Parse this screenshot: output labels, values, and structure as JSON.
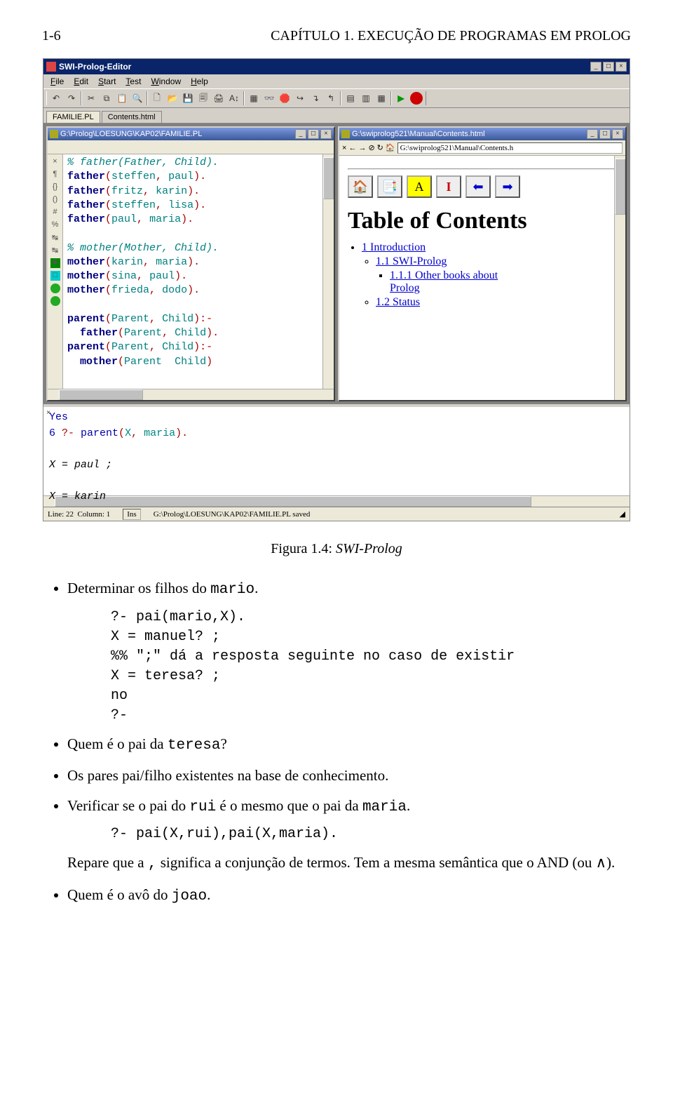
{
  "header": {
    "page_no": "1-6",
    "chapter": "CAPÍTULO 1. EXECUÇÃO DE PROGRAMAS EM PROLOG"
  },
  "caption": {
    "label": "Figura 1.4:",
    "text": "SWI-Prolog"
  },
  "app": {
    "title": "SWI-Prolog-Editor",
    "menu": [
      "File",
      "Edit",
      "Start",
      "Test",
      "Window",
      "Help"
    ],
    "tabs": [
      "FAMILIE.PL",
      "Contents.html"
    ],
    "left": {
      "title": "G:\\Prolog\\LOESUNG\\KAP02\\FAMILIE.PL",
      "gutter": [
        "×",
        "¶",
        "{}",
        "()",
        "#",
        "%",
        "↹",
        "↹",
        "■",
        "□",
        "✻",
        "✻"
      ],
      "code": [
        {
          "t": "com",
          "s": "% father(Father, Child)."
        },
        {
          "t": "l",
          "s": "father(steffen, paul)."
        },
        {
          "t": "l",
          "s": "father(fritz, karin)."
        },
        {
          "t": "l",
          "s": "father(steffen, lisa)."
        },
        {
          "t": "l",
          "s": "father(paul, maria)."
        },
        {
          "t": "blank",
          "s": ""
        },
        {
          "t": "com",
          "s": "% mother(Mother, Child)."
        },
        {
          "t": "l",
          "s": "mother(karin, maria)."
        },
        {
          "t": "l",
          "s": "mother(sina, paul)."
        },
        {
          "t": "l",
          "s": "mother(frieda, dodo)."
        },
        {
          "t": "blank",
          "s": ""
        },
        {
          "t": "l",
          "s": "parent(Parent, Child):-"
        },
        {
          "t": "l",
          "s": "  father(Parent, Child)."
        },
        {
          "t": "l",
          "s": "parent(Parent, Child):-"
        },
        {
          "t": "l",
          "s": "  mother(Parent  Child)"
        }
      ]
    },
    "right": {
      "title": "G:\\swiprolog521\\Manual\\Contents.html",
      "addr": "G:\\swiprolog521\\Manual\\Contents.h",
      "h1": "Table of Contents",
      "toc": {
        "l1": "1 Introduction",
        "l11": "1.1 SWI-Prolog",
        "l111a": "1.1.1 Other books about",
        "l111b": "Prolog",
        "l12": "1.2 Status"
      }
    },
    "console": {
      "l1_a": "Yes",
      "l2_a": "6 ",
      "l2_b": "?- ",
      "l2_c": "parent",
      "l2_d": "(",
      "l2_e": "X",
      "l2_f": ", ",
      "l2_g": "maria",
      "l2_h": ").",
      "l3": "X = paul ;",
      "l4": "X = karin"
    },
    "status": {
      "line_lbl": "Line:",
      "line_val": "22",
      "col_lbl": "Column:",
      "col_val": "1",
      "ins": "Ins",
      "msg": "G:\\Prolog\\LOESUNG\\KAP02\\FAMILIE.PL saved"
    }
  },
  "body": {
    "b1": "Determinar os filhos do ",
    "b1_code": "mario",
    "b1_tail": ".",
    "q1": "?- pai(mario,X).\nX = manuel? ;\n%% \";\" dá a resposta seguinte no caso de existir\nX = teresa? ;\nno\n?-",
    "b2": "Quem é o pai da ",
    "b2_code": "teresa",
    "b2_tail": "?",
    "b3": "Os pares pai/filho existentes na base de conhecimento.",
    "b4_a": "Verificar se o pai do ",
    "b4_code1": "rui",
    "b4_b": " é o mesmo que o pai da ",
    "b4_code2": "maria",
    "b4_tail": ".",
    "q2": "?- pai(X,rui),pai(X,maria).",
    "b5_a": "Repare que a ",
    "b5_comma": ",",
    "b5_b": " significa a conjunção de termos. Tem a mesma semântica que o AND (ou ∧).",
    "b6_a": "Quem é o avô do ",
    "b6_code": "joao",
    "b6_tail": "."
  }
}
